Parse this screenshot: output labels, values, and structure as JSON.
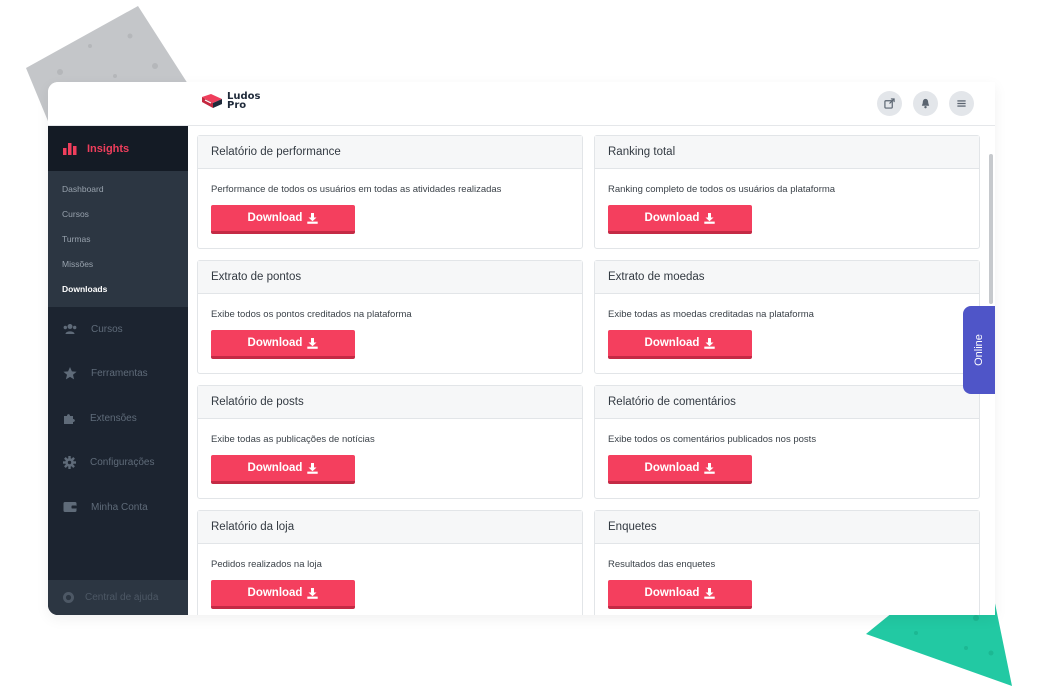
{
  "app": {
    "logo_line1": "Ludos",
    "logo_line2": "Pro"
  },
  "topbar": {
    "icons": [
      "external-link-icon",
      "bell-icon",
      "menu-icon"
    ]
  },
  "sidebar": {
    "section": {
      "label": "Insights",
      "icon": "bar-chart-icon"
    },
    "subitems": [
      {
        "label": "Dashboard"
      },
      {
        "label": "Cursos"
      },
      {
        "label": "Turmas"
      },
      {
        "label": "Missões"
      },
      {
        "label": "Downloads",
        "active": true
      }
    ],
    "items": [
      {
        "label": "Cursos",
        "icon": "users-icon"
      },
      {
        "label": "Ferramentas",
        "icon": "star-icon"
      },
      {
        "label": "Extensões",
        "icon": "puzzle-icon"
      },
      {
        "label": "Configurações",
        "icon": "gear-icon"
      },
      {
        "label": "Minha Conta",
        "icon": "wallet-icon"
      }
    ],
    "help": {
      "label": "Central de ajuda",
      "icon": "lifebuoy-icon"
    }
  },
  "cards": [
    {
      "title": "Relatório de performance",
      "description": "Performance de todos os usuários em todas as atividades realizadas",
      "button": "Download"
    },
    {
      "title": "Ranking total",
      "description": "Ranking completo de todos os usuários da plataforma",
      "button": "Download"
    },
    {
      "title": "Extrato de pontos",
      "description": "Exibe todos os pontos creditados na plataforma",
      "button": "Download"
    },
    {
      "title": "Extrato de moedas",
      "description": "Exibe todas as moedas creditadas na plataforma",
      "button": "Download"
    },
    {
      "title": "Relatório de posts",
      "description": "Exibe todas as publicações de notícias",
      "button": "Download"
    },
    {
      "title": "Relatório de comentários",
      "description": "Exibe todos os comentários publicados nos posts",
      "button": "Download"
    },
    {
      "title": "Relatório da loja",
      "description": "Pedidos realizados na loja",
      "button": "Download"
    },
    {
      "title": "Enquetes",
      "description": "Resultados das enquetes",
      "button": "Download"
    }
  ],
  "online_tab": {
    "label": "Online"
  },
  "colors": {
    "accent": "#f43f5e",
    "sidebar_bg": "#1c2430",
    "online_tab": "#4f55c8",
    "deco_green": "#22c9a3"
  }
}
